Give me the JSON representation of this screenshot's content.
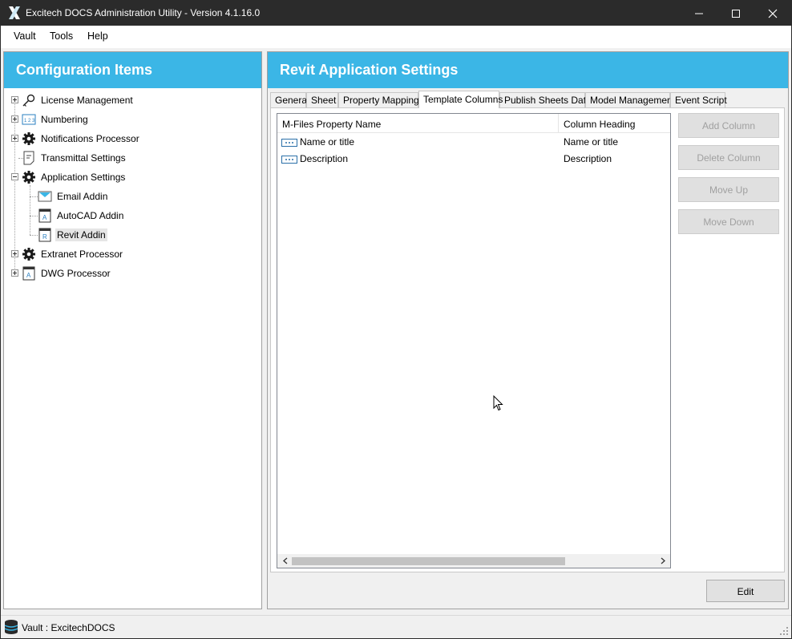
{
  "window": {
    "title": "Excitech DOCS Administration Utility - Version 4.1.16.0",
    "app_icon": "excitech-x-icon"
  },
  "menu": [
    "Vault",
    "Tools",
    "Help"
  ],
  "left_panel": {
    "header": "Configuration Items",
    "tree": [
      {
        "label": "License Management",
        "icon": "key-icon"
      },
      {
        "label": "Numbering",
        "icon": "numbering-icon"
      },
      {
        "label": "Notifications Processor",
        "icon": "gear-icon"
      },
      {
        "label": "Transmittal Settings",
        "icon": "document-icon"
      },
      {
        "label": "Application Settings",
        "icon": "gear-icon"
      },
      {
        "label": "Email Addin",
        "icon": "email-icon"
      },
      {
        "label": "AutoCAD Addin",
        "icon": "autocad-icon"
      },
      {
        "label": "Revit Addin",
        "icon": "revit-icon"
      },
      {
        "label": "Extranet Processor",
        "icon": "gear-icon"
      },
      {
        "label": "DWG Processor",
        "icon": "autocad-icon"
      }
    ]
  },
  "right_panel": {
    "header": "Revit Application Settings",
    "tabs": [
      "General",
      "Sheet",
      "Property Mapping",
      "Template Columns",
      "Publish Sheets Data",
      "Model Management",
      "Event Script"
    ],
    "active_tab": "Template Columns",
    "list": {
      "columns": [
        "M-Files Property Name",
        "Column Heading"
      ],
      "rows": [
        {
          "property": "Name or title",
          "heading": "Name or title",
          "icon": "property-icon"
        },
        {
          "property": "Description",
          "heading": "Description",
          "icon": "property-icon"
        }
      ]
    },
    "buttons": {
      "add_column": "Add Column",
      "delete_column": "Delete Column",
      "move_up": "Move Up",
      "move_down": "Move Down",
      "edit": "Edit"
    }
  },
  "status": {
    "text": "Vault : ExcitechDOCS",
    "icon": "database-icon"
  },
  "colors": {
    "header_blue": "#3bb6e6",
    "titlebar": "#2b2b2b"
  }
}
